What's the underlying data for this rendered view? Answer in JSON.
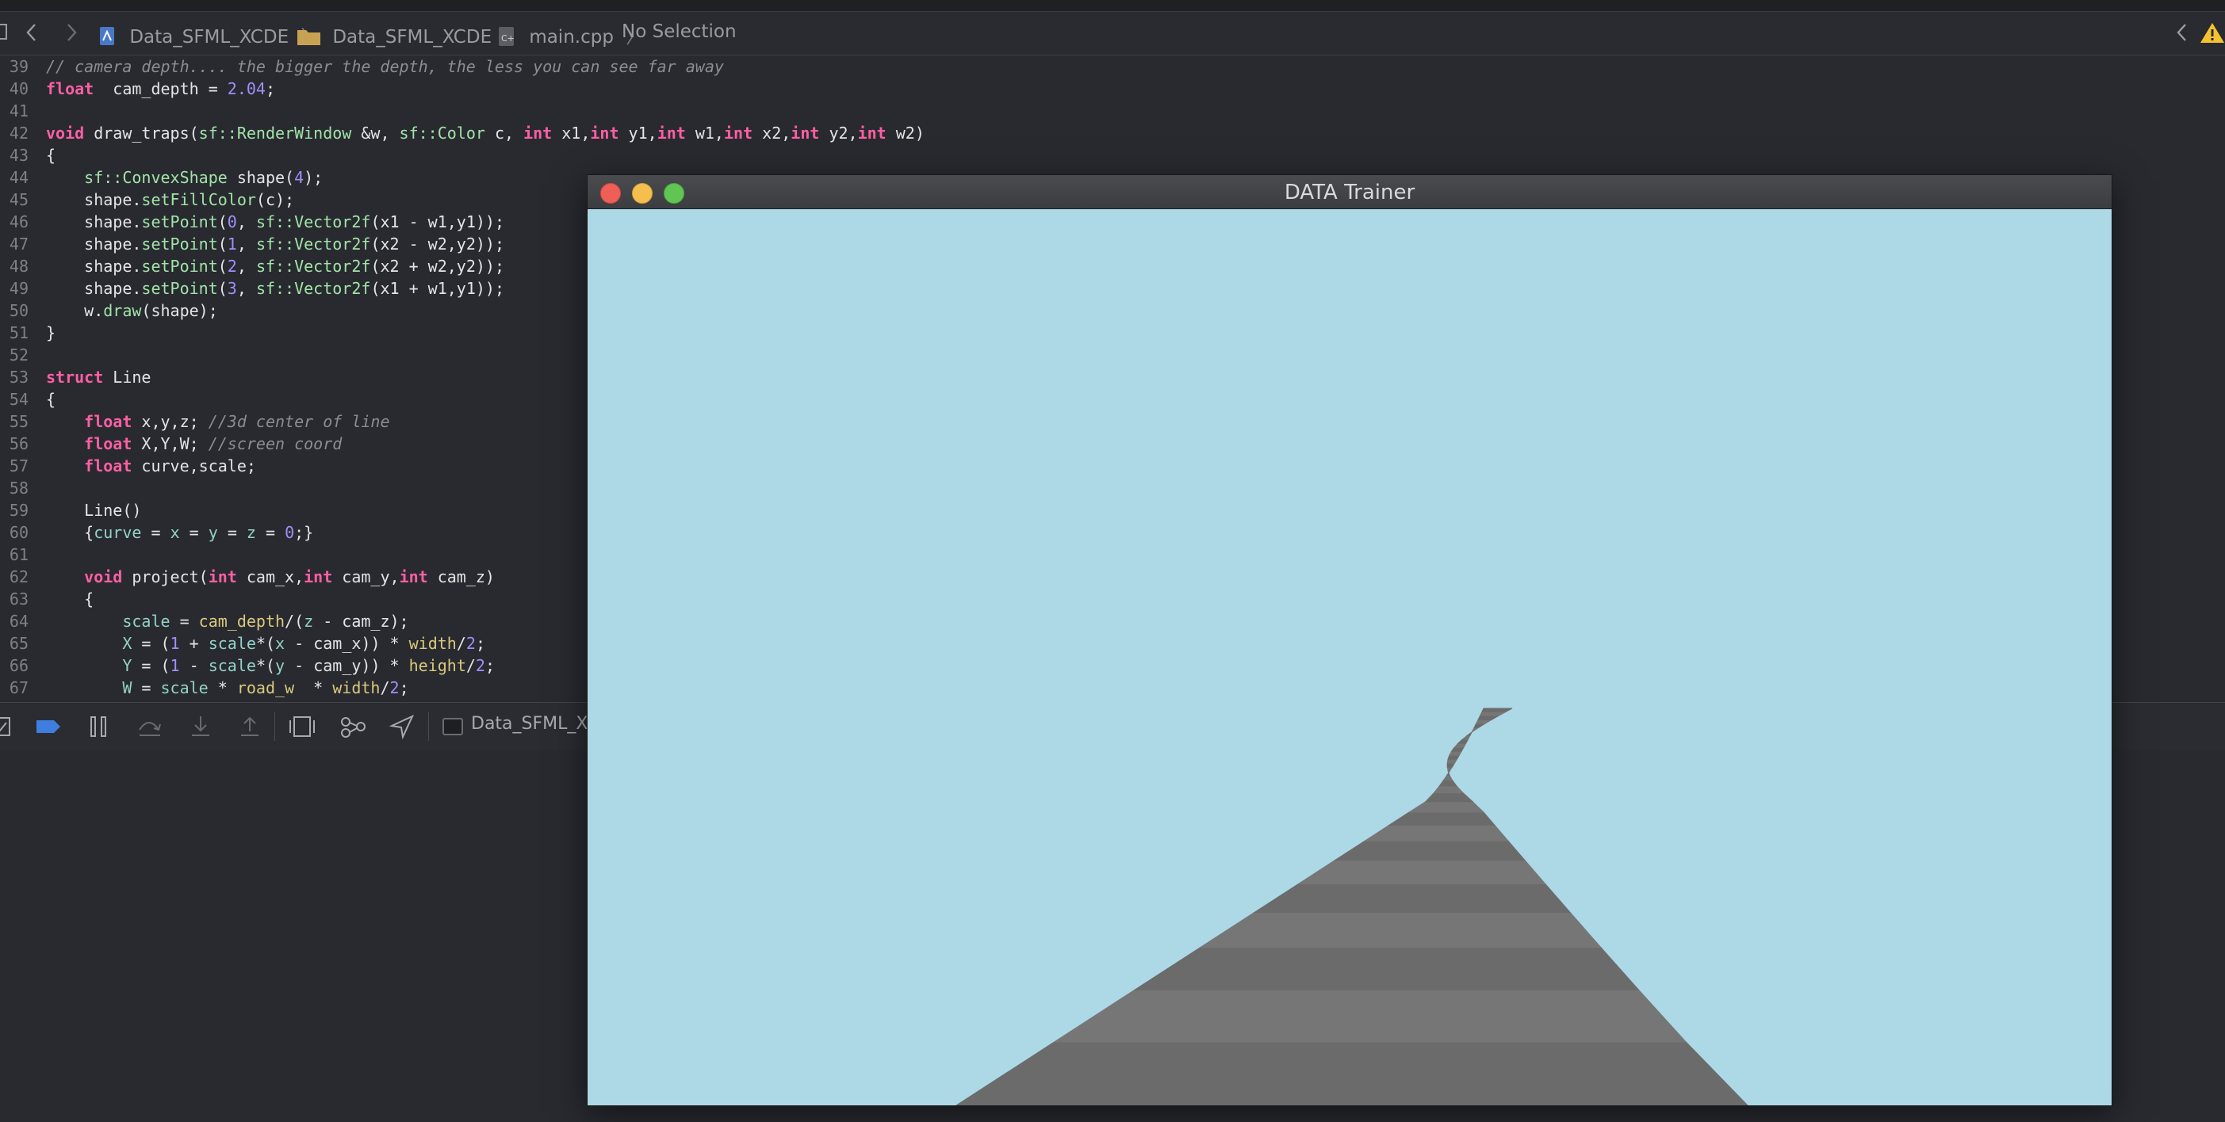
{
  "jumpbar": {
    "crumbs": [
      "Data_SFML_XCDE",
      "Data_SFML_XCDE",
      "main.cpp",
      "No Selection"
    ]
  },
  "editor": {
    "lines": [
      {
        "n": "39",
        "t": [
          [
            "cm",
            "// camera depth.... the bigger the depth, the less you can see far away"
          ]
        ]
      },
      {
        "n": "40",
        "t": [
          [
            "kw",
            "float"
          ],
          [
            "",
            "  cam_depth = "
          ],
          [
            "num",
            "2.04"
          ],
          [
            "",
            ";"
          ]
        ]
      },
      {
        "n": "41",
        "t": []
      },
      {
        "n": "42",
        "t": [
          [
            "kw",
            "void"
          ],
          [
            "",
            " draw_traps("
          ],
          [
            "ty",
            "sf::RenderWindow"
          ],
          [
            "",
            " &w, "
          ],
          [
            "ty",
            "sf::Color"
          ],
          [
            "",
            " c, "
          ],
          [
            "kw",
            "int"
          ],
          [
            "",
            " x1,"
          ],
          [
            "kw",
            "int"
          ],
          [
            "",
            " y1,"
          ],
          [
            "kw",
            "int"
          ],
          [
            "",
            " w1,"
          ],
          [
            "kw",
            "int"
          ],
          [
            "",
            " x2,"
          ],
          [
            "kw",
            "int"
          ],
          [
            "",
            " y2,"
          ],
          [
            "kw",
            "int"
          ],
          [
            "",
            " w2)"
          ]
        ]
      },
      {
        "n": "43",
        "t": [
          [
            "",
            "{"
          ]
        ]
      },
      {
        "n": "44",
        "t": [
          [
            "",
            "    "
          ],
          [
            "ty",
            "sf::ConvexShape"
          ],
          [
            "",
            " shape("
          ],
          [
            "num",
            "4"
          ],
          [
            "",
            ");"
          ]
        ]
      },
      {
        "n": "45",
        "t": [
          [
            "",
            "    shape."
          ],
          [
            "ty",
            "setFillColor"
          ],
          [
            "",
            "(c);"
          ]
        ]
      },
      {
        "n": "46",
        "t": [
          [
            "",
            "    shape."
          ],
          [
            "ty",
            "setPoint"
          ],
          [
            "",
            "("
          ],
          [
            "num",
            "0"
          ],
          [
            "",
            ", "
          ],
          [
            "ty",
            "sf::Vector2f"
          ],
          [
            "",
            "(x1 - w1,y1));"
          ]
        ]
      },
      {
        "n": "47",
        "t": [
          [
            "",
            "    shape."
          ],
          [
            "ty",
            "setPoint"
          ],
          [
            "",
            "("
          ],
          [
            "num",
            "1"
          ],
          [
            "",
            ", "
          ],
          [
            "ty",
            "sf::Vector2f"
          ],
          [
            "",
            "(x2 - w2,y2));"
          ]
        ]
      },
      {
        "n": "48",
        "t": [
          [
            "",
            "    shape."
          ],
          [
            "ty",
            "setPoint"
          ],
          [
            "",
            "("
          ],
          [
            "num",
            "2"
          ],
          [
            "",
            ", "
          ],
          [
            "ty",
            "sf::Vector2f"
          ],
          [
            "",
            "(x2 + w2,y2));"
          ]
        ]
      },
      {
        "n": "49",
        "t": [
          [
            "",
            "    shape."
          ],
          [
            "ty",
            "setPoint"
          ],
          [
            "",
            "("
          ],
          [
            "num",
            "3"
          ],
          [
            "",
            ", "
          ],
          [
            "ty",
            "sf::Vector2f"
          ],
          [
            "",
            "(x1 + w1,y1));"
          ]
        ]
      },
      {
        "n": "50",
        "t": [
          [
            "",
            "    w."
          ],
          [
            "ty",
            "draw"
          ],
          [
            "",
            "(shape);"
          ]
        ]
      },
      {
        "n": "51",
        "t": [
          [
            "",
            "}"
          ]
        ]
      },
      {
        "n": "52",
        "t": []
      },
      {
        "n": "53",
        "t": [
          [
            "kw",
            "struct"
          ],
          [
            "",
            " Line"
          ]
        ]
      },
      {
        "n": "54",
        "t": [
          [
            "",
            "{"
          ]
        ]
      },
      {
        "n": "55",
        "t": [
          [
            "",
            "    "
          ],
          [
            "kw",
            "float"
          ],
          [
            "",
            " x,y,z; "
          ],
          [
            "cm",
            "//3d center of line"
          ]
        ]
      },
      {
        "n": "56",
        "t": [
          [
            "",
            "    "
          ],
          [
            "kw",
            "float"
          ],
          [
            "",
            " X,Y,W; "
          ],
          [
            "cm",
            "//screen coord"
          ]
        ]
      },
      {
        "n": "57",
        "t": [
          [
            "",
            "    "
          ],
          [
            "kw",
            "float"
          ],
          [
            "",
            " curve,scale;"
          ]
        ]
      },
      {
        "n": "58",
        "t": []
      },
      {
        "n": "59",
        "t": [
          [
            "",
            "    Line()"
          ]
        ]
      },
      {
        "n": "60",
        "t": [
          [
            "",
            "    {"
          ],
          [
            "mb",
            "curve"
          ],
          [
            "",
            " = "
          ],
          [
            "mb",
            "x"
          ],
          [
            "",
            " = "
          ],
          [
            "mb",
            "y"
          ],
          [
            "",
            " = "
          ],
          [
            "mb",
            "z"
          ],
          [
            "",
            " = "
          ],
          [
            "num",
            "0"
          ],
          [
            "",
            ";}"
          ]
        ]
      },
      {
        "n": "61",
        "t": []
      },
      {
        "n": "62",
        "t": [
          [
            "",
            "    "
          ],
          [
            "kw",
            "void"
          ],
          [
            "",
            " project("
          ],
          [
            "kw",
            "int"
          ],
          [
            "",
            " cam_x,"
          ],
          [
            "kw",
            "int"
          ],
          [
            "",
            " cam_y,"
          ],
          [
            "kw",
            "int"
          ],
          [
            "",
            " cam_z)"
          ]
        ]
      },
      {
        "n": "63",
        "t": [
          [
            "",
            "    {"
          ]
        ]
      },
      {
        "n": "64",
        "t": [
          [
            "",
            "        "
          ],
          [
            "mb",
            "scale"
          ],
          [
            "",
            " = "
          ],
          [
            "pl",
            "cam_depth"
          ],
          [
            "",
            "/("
          ],
          [
            "mb",
            "z"
          ],
          [
            "",
            " - cam_z);"
          ]
        ]
      },
      {
        "n": "65",
        "t": [
          [
            "",
            "        "
          ],
          [
            "mb",
            "X"
          ],
          [
            "",
            " = ("
          ],
          [
            "num",
            "1"
          ],
          [
            "",
            " + "
          ],
          [
            "mb",
            "scale"
          ],
          [
            "",
            "*("
          ],
          [
            "mb",
            "x"
          ],
          [
            "",
            " - cam_x)) * "
          ],
          [
            "pl",
            "width"
          ],
          [
            "",
            "/"
          ],
          [
            "num",
            "2"
          ],
          [
            "",
            ";"
          ]
        ]
      },
      {
        "n": "66",
        "t": [
          [
            "",
            "        "
          ],
          [
            "mb",
            "Y"
          ],
          [
            "",
            " = ("
          ],
          [
            "num",
            "1"
          ],
          [
            "",
            " - "
          ],
          [
            "mb",
            "scale"
          ],
          [
            "",
            "*("
          ],
          [
            "mb",
            "y"
          ],
          [
            "",
            " - cam_y)) * "
          ],
          [
            "pl",
            "height"
          ],
          [
            "",
            "/"
          ],
          [
            "num",
            "2"
          ],
          [
            "",
            ";"
          ]
        ]
      },
      {
        "n": "67",
        "t": [
          [
            "",
            "        "
          ],
          [
            "mb",
            "W"
          ],
          [
            "",
            " = "
          ],
          [
            "mb",
            "scale"
          ],
          [
            "",
            " * "
          ],
          [
            "pl",
            "road_w"
          ],
          [
            "",
            "  * "
          ],
          [
            "pl",
            "width"
          ],
          [
            "",
            "/"
          ],
          [
            "num",
            "2"
          ],
          [
            "",
            ";"
          ]
        ]
      }
    ]
  },
  "debug": {
    "target_label": "Data_SFML_X",
    "icons": [
      "breakpoint-toggle-icon",
      "breakpoints-active-icon",
      "pause-icon",
      "step-over-icon",
      "step-into-icon",
      "step-out-icon",
      "view-hierarchy-icon",
      "memory-graph-icon",
      "simulate-location-icon"
    ]
  },
  "app_window": {
    "title": "DATA Trainer",
    "sky_color": "#add8e6",
    "road_colors": [
      "#6b6b6b",
      "#767676"
    ]
  }
}
